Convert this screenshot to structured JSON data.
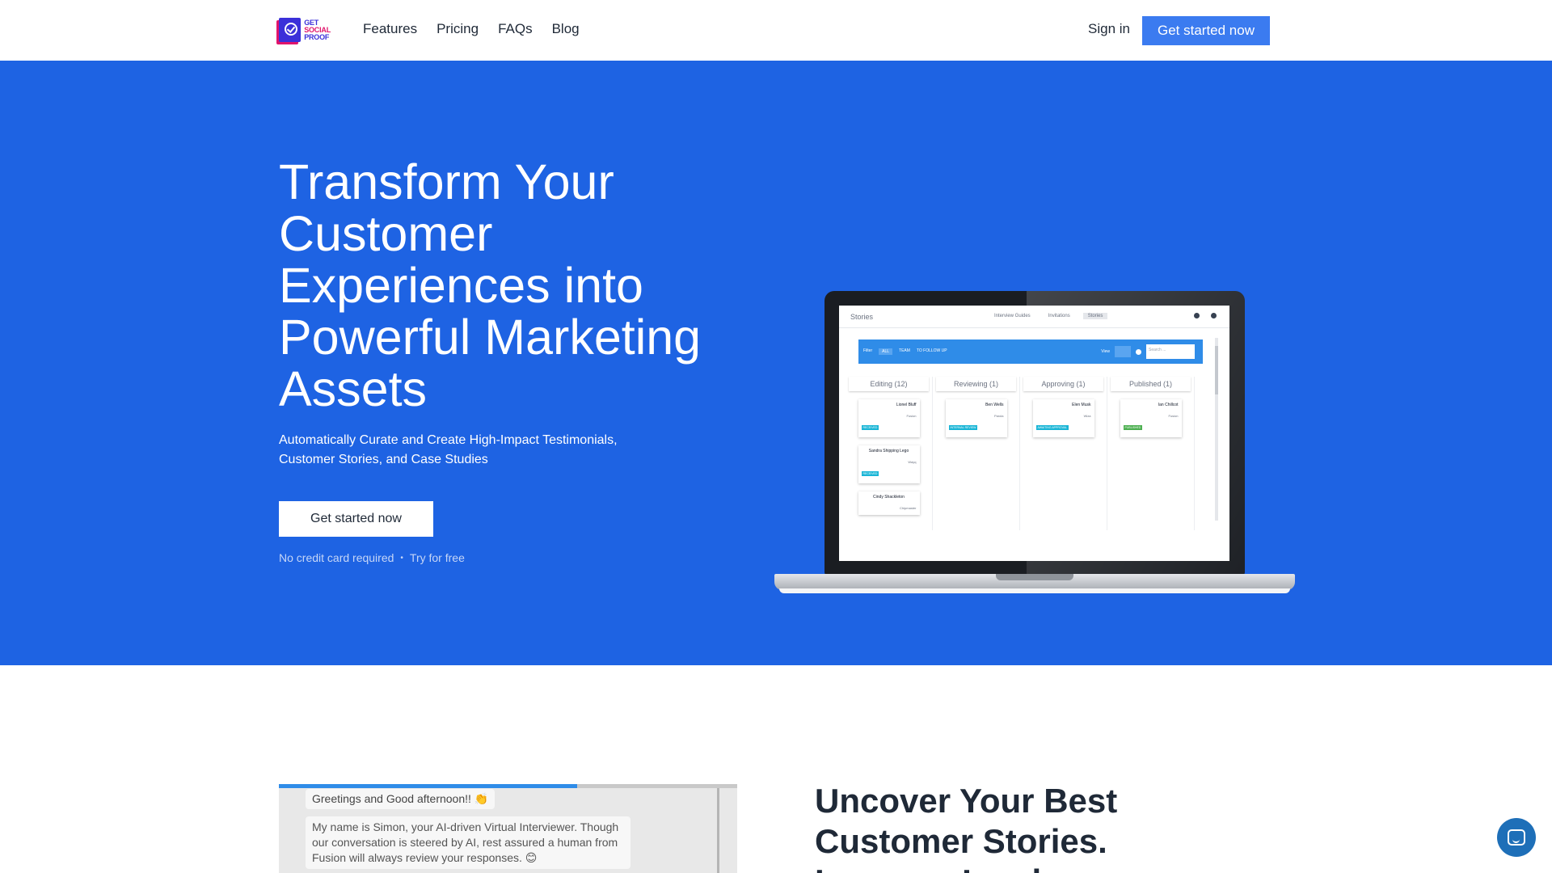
{
  "nav": {
    "logo_lines": [
      "GET",
      "SOCIAL",
      "PROOF"
    ],
    "links": [
      "Features",
      "Pricing",
      "FAQs",
      "Blog"
    ],
    "signin": "Sign in",
    "cta": "Get started now"
  },
  "hero": {
    "title": "Transform Your Customer Experiences into Powerful Marketing Assets",
    "subtitle": "Automatically Curate and Create High-Impact Testimonials, Customer Stories, and Case Studies",
    "cta": "Get started now",
    "note_1": "No credit card required",
    "note_sep": "•",
    "note_2": "Try for free",
    "bg_color": "#1e63e3"
  },
  "screen": {
    "title": "Stories",
    "tabs": [
      "Interview Guides",
      "Invitations",
      "Stories"
    ],
    "toolbar": {
      "filters": [
        "Filter",
        "ALL",
        "TEAM",
        "TO FOLLOW UP"
      ],
      "view": "View",
      "search_placeholder": "Search ..."
    },
    "columns": [
      {
        "title": "Editing (12)",
        "cards": [
          {
            "name": "Lionel Bluff",
            "company": "Fusion",
            "tag": "RECEIVED",
            "tag_color": "#19b5d6"
          },
          {
            "name": "Sandra Shipping Lego",
            "company": "Wayq",
            "tag": "RECEIVED",
            "tag_color": "#19b5d6"
          },
          {
            "name": "Cindy Shackleton",
            "company": "Chipmaster",
            "tag": "",
            "tag_color": ""
          }
        ]
      },
      {
        "title": "Reviewing (1)",
        "cards": [
          {
            "name": "Ben Wells",
            "company": "Parola",
            "tag": "INTERNAL REVIEW",
            "tag_color": "#19b5d6"
          }
        ]
      },
      {
        "title": "Approving (1)",
        "cards": [
          {
            "name": "Elen Musk",
            "company": "Wiza",
            "tag": "AWAITING APPROVAL",
            "tag_color": "#19b5d6"
          }
        ]
      },
      {
        "title": "Published (1)",
        "cards": [
          {
            "name": "Ian Chillcot",
            "company": "Fusion",
            "tag": "PUBLISHED",
            "tag_color": "#4caf50"
          }
        ]
      }
    ]
  },
  "section2": {
    "chat_greeting": "Greetings and Good afternoon!! 👏",
    "chat_intro": "My name is Simon, your AI-driven Virtual Interviewer. Though our conversation is steered by AI, rest assured a human from Fusion will always review your responses. 😊",
    "progress": 0.65,
    "title": "Uncover Your Best Customer Stories. Increase Lead"
  },
  "chat_widget": {
    "icon": "chat-icon"
  }
}
